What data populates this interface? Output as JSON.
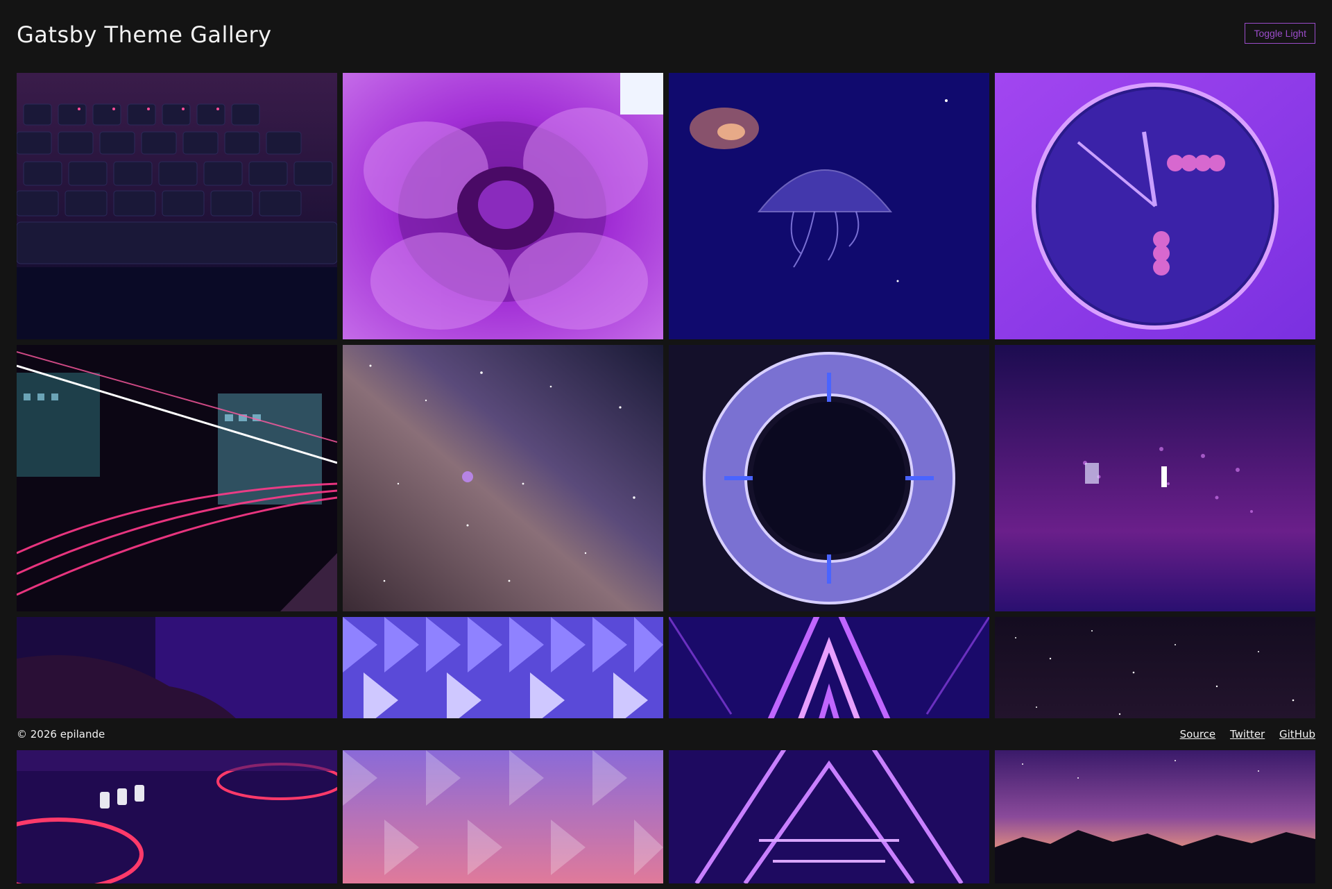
{
  "header": {
    "title": "Gatsby Theme Gallery",
    "toggle_label": "Toggle Light"
  },
  "gallery": {
    "tiles": [
      {
        "icon": "keyboard-photo"
      },
      {
        "icon": "flower-photo"
      },
      {
        "icon": "jellyfish-photo"
      },
      {
        "icon": "clock-photo"
      },
      {
        "icon": "light-trails-photo"
      },
      {
        "icon": "milky-way-photo"
      },
      {
        "icon": "geometric-structure-photo"
      },
      {
        "icon": "rainy-window-photo"
      },
      {
        "icon": "dj-hand-photo"
      },
      {
        "icon": "faceted-dome-photo"
      },
      {
        "icon": "neon-triangle-tunnel-photo"
      },
      {
        "icon": "starry-sky-photo"
      },
      {
        "icon": "dj-turntable-photo"
      },
      {
        "icon": "faceted-dome-pink-photo"
      },
      {
        "icon": "neon-triangle-corridor-photo"
      },
      {
        "icon": "sunset-mountains-photo"
      }
    ]
  },
  "footer": {
    "copyright": "© 2026 epilande",
    "links": [
      "Source",
      "Twitter",
      "GitHub"
    ]
  },
  "colors": {
    "background": "#141414",
    "accent": "#9b4dca",
    "text": "#f2f2f2"
  }
}
